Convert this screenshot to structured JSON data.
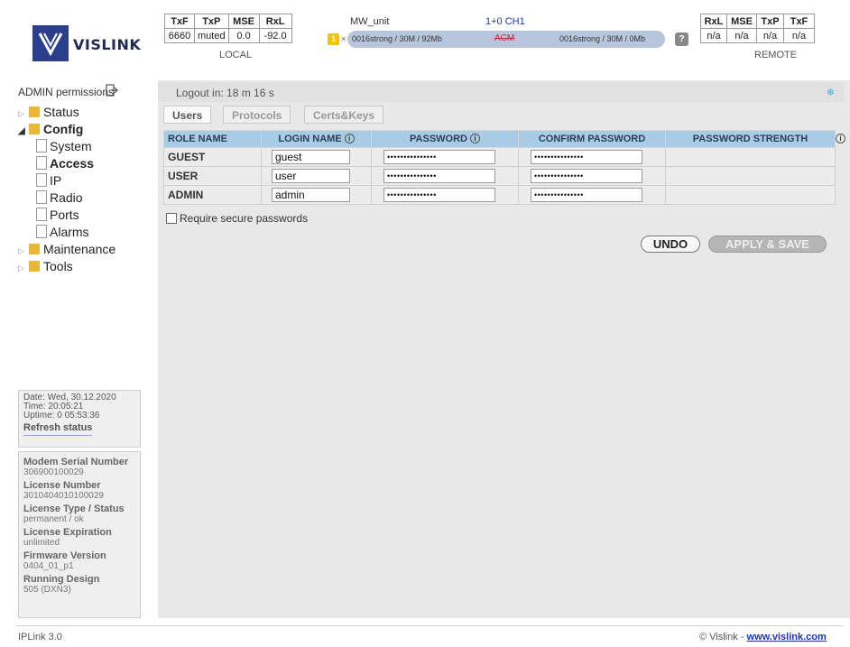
{
  "header": {
    "logo_text": "VISLINK",
    "local": {
      "headers": [
        "TxF",
        "TxP",
        "MSE",
        "RxL"
      ],
      "values": [
        "6660",
        "muted",
        "0.0",
        "-92.0"
      ],
      "label": "LOCAL"
    },
    "remote": {
      "headers": [
        "RxL",
        "MSE",
        "TxP",
        "TxF"
      ],
      "values": [
        "n/a",
        "n/a",
        "n/a",
        "n/a"
      ],
      "label": "REMOTE"
    },
    "unit_name": "MW_unit",
    "channel": "1+0 CH1",
    "link_number": "1",
    "link_x": "×",
    "link_left": "0016strong / 30M / 92Mb",
    "link_acm": "ACM",
    "link_right": "0016strong / 30M / 0Mb",
    "help": "?"
  },
  "sidebar": {
    "admin_permissions": "ADMIN permissions",
    "tree": {
      "status": "Status",
      "config": "Config",
      "system": "System",
      "access": "Access",
      "ip": "IP",
      "radio": "Radio",
      "ports": "Ports",
      "alarms": "Alarms",
      "maintenance": "Maintenance",
      "tools": "Tools"
    },
    "status_box": {
      "date": "Date: Wed, 30.12.2020",
      "time": "Time: 20:05:21",
      "uptime": "Uptime: 0 05:53:36",
      "refresh": "Refresh status"
    },
    "info": {
      "serial_title": "Modem Serial Number",
      "serial": "306900100029",
      "license_title": "License Number",
      "license": "3010404010100029",
      "license_type_title": "License Type / Status",
      "license_type": "permanent / ok",
      "expiration_title": "License Expiration",
      "expiration": "unlimited",
      "firmware_title": "Firmware Version",
      "firmware": "0404_01_p1",
      "design_title": "Running Design",
      "design": "505 (DXN3)"
    }
  },
  "main": {
    "logout": "Logout in: 18 m 16 s",
    "tabs": [
      "Users",
      "Protocols",
      "Certs&Keys"
    ],
    "table": {
      "headers": [
        "ROLE NAME",
        "LOGIN NAME",
        "PASSWORD",
        "CONFIRM PASSWORD",
        "PASSWORD STRENGTH"
      ],
      "info_glyph": "i",
      "rows": [
        {
          "role": "GUEST",
          "login": "guest",
          "password": "•••••••••••••••",
          "confirm": "•••••••••••••••"
        },
        {
          "role": "USER",
          "login": "user",
          "password": "•••••••••••••••",
          "confirm": "•••••••••••••••"
        },
        {
          "role": "ADMIN",
          "login": "admin",
          "password": "•••••••••••••••",
          "confirm": "•••••••••••••••"
        }
      ]
    },
    "secure_passwords": "Require secure passwords",
    "undo": "UNDO",
    "apply": "APPLY & SAVE"
  },
  "footer": {
    "version": "IPLink 3.0",
    "copyright": "© Vislink - ",
    "link": "www.vislink.com"
  },
  "colors": {
    "header_blue": "#a8cbe6",
    "logo_blue": "#2b3f8c",
    "link_blue": "#1a35b8",
    "folder_yellow": "#e9b635",
    "panel_gray": "#e8e8e8"
  }
}
